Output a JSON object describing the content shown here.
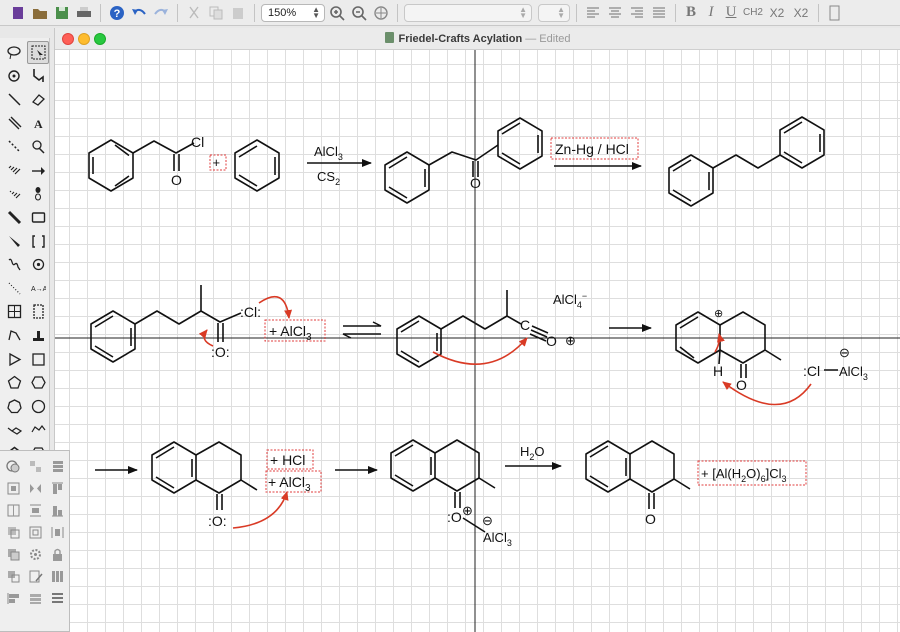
{
  "toolbar": {
    "zoom": "150%",
    "text_format": {
      "bold": "B",
      "italic": "I",
      "underline": "U",
      "chemical": "CH2",
      "subscript": "X2",
      "superscript": "X2"
    },
    "icons": [
      "new-document-icon",
      "open-folder-icon",
      "save-icon",
      "print-icon",
      "help-icon",
      "undo-icon",
      "redo-icon",
      "cut-icon",
      "copy-icon",
      "paste-icon",
      "zoom-in-icon",
      "zoom-out-icon",
      "pan-icon",
      "align-left-icon",
      "align-center-icon",
      "align-right-icon",
      "justify-icon"
    ]
  },
  "window": {
    "title": "Friedel-Crafts Acylation",
    "status": "Edited",
    "separator": "—"
  },
  "scheme": {
    "row1": {
      "acyl_chloride_cl": "Cl",
      "acyl_chloride_o": "O",
      "plus": "+",
      "reagent_top": "AlCl3",
      "reagent_bottom": "CS2",
      "ketone_o": "O",
      "reduction": "Zn-Hg / HCl"
    },
    "row2": {
      "cl": ":Cl:",
      "o": ":O:",
      "plus_alcl3": "+ AlCl3",
      "alcl4": "AlCl4−",
      "acylium_c": "C",
      "acylium_o": "O",
      "charge_plus": "⊕",
      "h": "H",
      "ketone_o": "O",
      "cl_alcl3": ":Cl",
      "alcl3": "AlCl3",
      "charge_minus": "⊖"
    },
    "row3": {
      "plus_hcl": "+ HCl",
      "plus_alcl3": "+ AlCl3",
      "o": ":O:",
      "complex_o": ":O",
      "complex_alcl3": "AlCl3",
      "water": "H2O",
      "product_o": "O",
      "byproduct": "+ [Al(H2O)6]Cl3"
    }
  },
  "colors": {
    "accent_red": "#d93a25",
    "box_red": "#e03c3c",
    "grid": "#dedede"
  }
}
